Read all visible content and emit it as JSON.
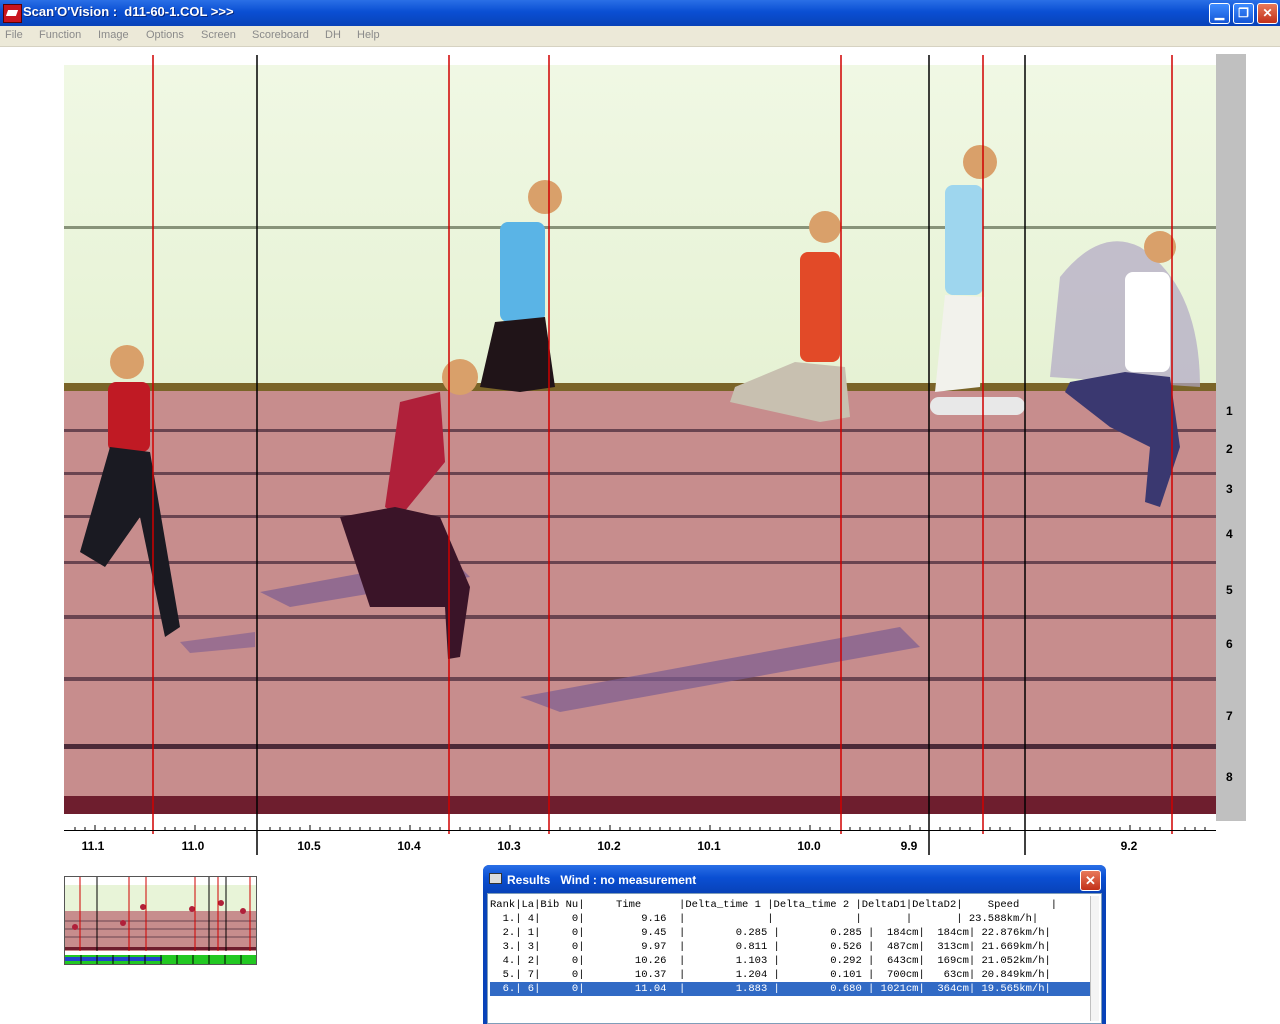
{
  "window": {
    "title": "Scan'O'Vision :  d11-60-1.COL >>>",
    "min_glyph": "▁",
    "max_glyph": "❐",
    "close_glyph": "✕"
  },
  "menu": [
    "File",
    "Function",
    "Image",
    "Options",
    "Screen",
    "Scoreboard",
    "DH",
    "Help"
  ],
  "lanes": [
    "1",
    "2",
    "3",
    "4",
    "5",
    "6",
    "7",
    "8"
  ],
  "time_axis_labels": [
    "11.1",
    "11.0",
    "10.5",
    "10.4",
    "10.3",
    "10.2",
    "10.1",
    "10.0",
    "9.9",
    "9.2"
  ],
  "results": {
    "title": "Results   Wind : no measurement",
    "header": "Rank|La|Bib Nu|     Time      |Delta_time 1 |Delta_time 2 |DeltaD1|DeltaD2|    Speed     |",
    "rows": [
      "  1.| 4|     0|         9.16  |             |             |       |       | 23.588km/h|",
      "  2.| 1|     0|         9.45  |        0.285 |        0.285 |  184cm|  184cm| 22.876km/h|",
      "  3.| 3|     0|         9.97  |        0.811 |        0.526 |  487cm|  313cm| 21.669km/h|",
      "  4.| 2|     0|        10.26  |        1.103 |        0.292 |  643cm|  169cm| 21.052km/h|",
      "  5.| 7|     0|        10.37  |        1.204 |        0.101 |  700cm|   63cm| 20.849km/h|",
      "  6.| 6|     0|        11.04  |        1.883 |        0.680 | 1021cm|  364cm| 19.565km/h|"
    ],
    "selected_row": 5
  },
  "icons": {
    "app": "scanovision-logo-icon",
    "printer": "printer-icon",
    "close": "close-icon"
  },
  "colors": {
    "finish_line": "#d00000",
    "track": "#c98a8a",
    "sky": "#eef6dc",
    "selection": "#316ac5"
  }
}
